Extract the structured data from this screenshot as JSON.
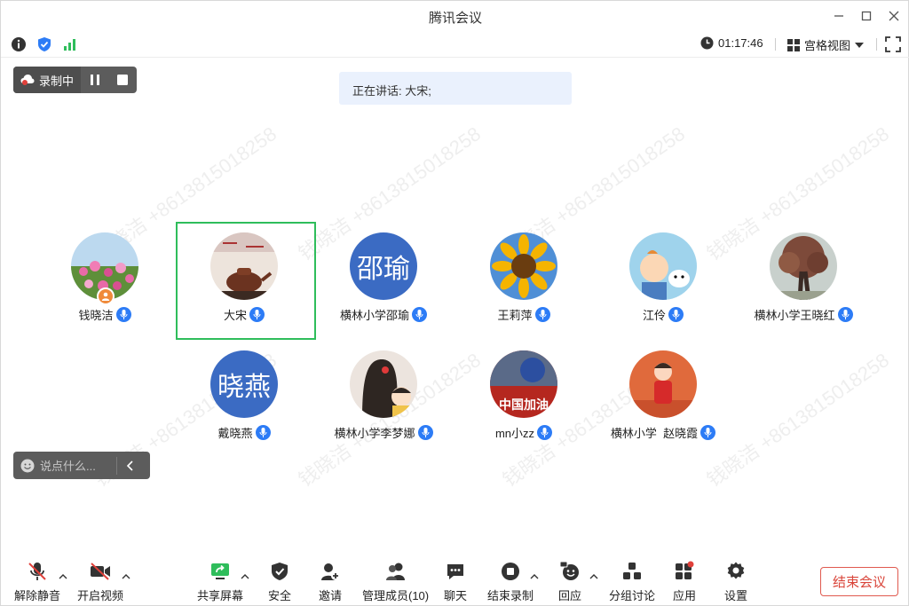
{
  "app": {
    "title": "腾讯会议"
  },
  "infobar": {
    "timer": "01:17:46",
    "view_label": "宫格视图"
  },
  "recording": {
    "label": "录制中"
  },
  "speaking": {
    "text": "正在讲话: 大宋;"
  },
  "participants": [
    {
      "name": "钱晓洁",
      "avatar": "flowers-photo",
      "host": true
    },
    {
      "name": "大宋",
      "avatar": "teapot-photo",
      "active": true
    },
    {
      "name": "横林小学邵瑜",
      "avatar_text": "邵瑜"
    },
    {
      "name": "王莉萍",
      "avatar": "sunflower-photo"
    },
    {
      "name": "江伶",
      "avatar": "cartoon-photo"
    },
    {
      "name": "横林小学王晓红",
      "avatar": "tree-photo"
    },
    {
      "name": "戴晓燕",
      "avatar_text": "晓燕"
    },
    {
      "name": "横林小学李梦娜",
      "avatar": "girl-drawing-photo"
    },
    {
      "name": "mn小zz",
      "avatar": "china-jiayou-photo",
      "avatar_caption": "中国加油"
    },
    {
      "name": "横林小学  赵晓霞",
      "avatar": "baby-photo"
    }
  ],
  "watermark": "钱晓洁 +8613815018258",
  "chat": {
    "placeholder": "说点什么..."
  },
  "toolbar": {
    "unmute": "解除静音",
    "start_video": "开启视频",
    "share_screen": "共享屏幕",
    "security": "安全",
    "invite": "邀请",
    "manage_members": "管理成员(10)",
    "chat": "聊天",
    "stop_recording": "结束录制",
    "reactions": "回应",
    "breakout": "分组讨论",
    "apps": "应用",
    "settings": "设置",
    "end_meeting": "结束会议"
  },
  "colors": {
    "accent": "#2d7cf6",
    "active_border": "#2fbd5b",
    "end_red": "#d9453a",
    "avatar_blue": "#3b6bc3"
  }
}
